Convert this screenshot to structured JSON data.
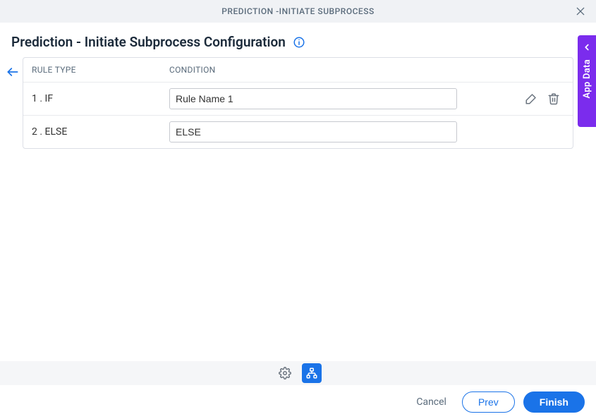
{
  "topbar": {
    "title": "PREDICTION -INITIATE SUBPROCESS"
  },
  "header": {
    "title": "Prediction - Initiate Subprocess Configuration"
  },
  "table": {
    "headers": {
      "rule_type": "RULE TYPE",
      "condition": "CONDITION"
    },
    "rows": [
      {
        "index_label": "1 . IF",
        "condition": "Rule Name 1",
        "has_actions": true
      },
      {
        "index_label": "2 . ELSE",
        "condition": "ELSE",
        "has_actions": false
      }
    ]
  },
  "side_tab": {
    "label": "App Data"
  },
  "footer": {
    "cancel": "Cancel",
    "prev": "Prev",
    "finish": "Finish"
  }
}
